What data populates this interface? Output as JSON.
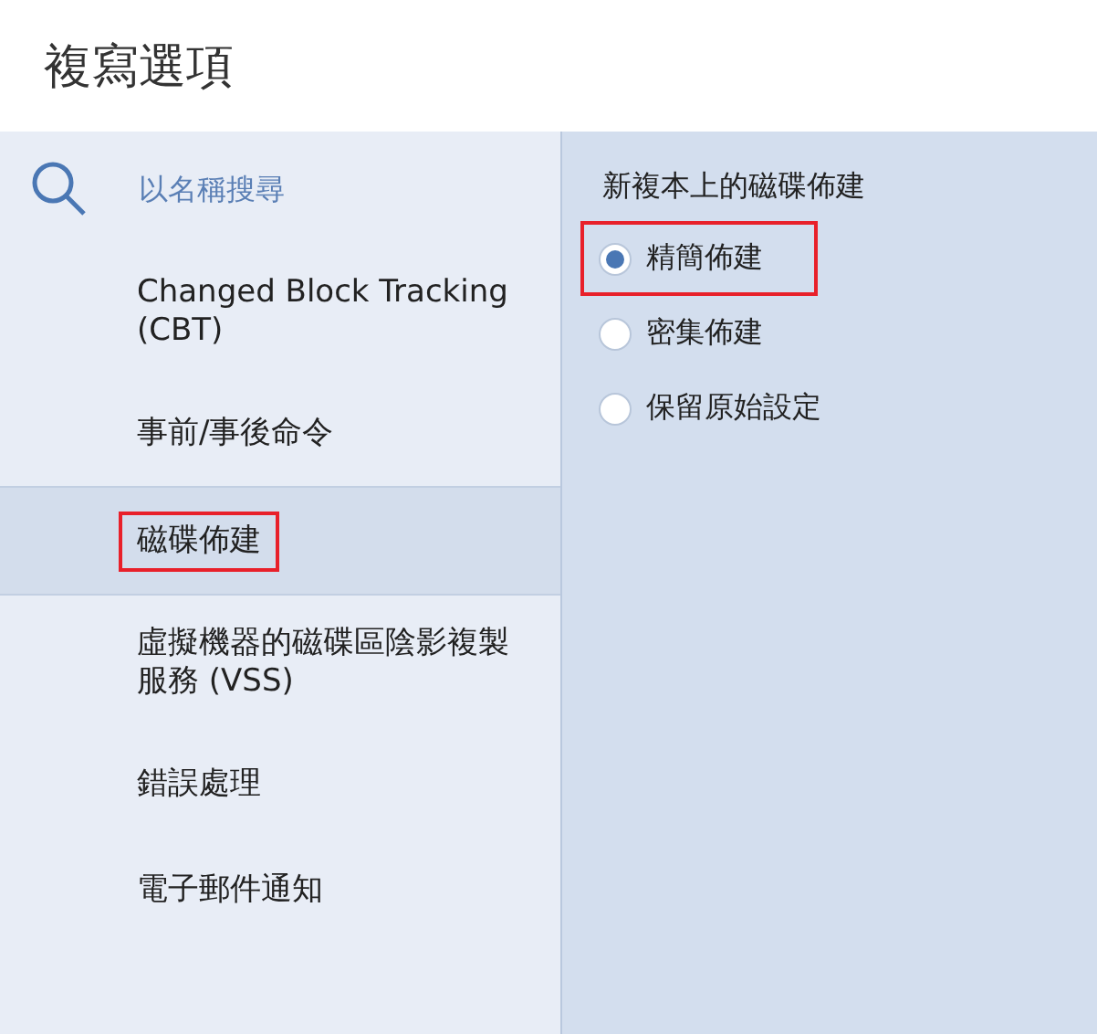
{
  "window": {
    "title": "複寫選項"
  },
  "sidebar": {
    "search": {
      "placeholder": "以名稱搜尋"
    },
    "items": [
      {
        "label": "Changed Block Tracking (CBT)",
        "selected": false,
        "highlighted": false
      },
      {
        "label": "事前/事後命令",
        "selected": false,
        "highlighted": false
      },
      {
        "label": "磁碟佈建",
        "selected": true,
        "highlighted": true
      },
      {
        "label": "虛擬機器的磁碟區陰影複製服務 (VSS)",
        "selected": false,
        "highlighted": false
      },
      {
        "label": "錯誤處理",
        "selected": false,
        "highlighted": false
      },
      {
        "label": "電子郵件通知",
        "selected": false,
        "highlighted": false
      }
    ]
  },
  "panel": {
    "heading": "新複本上的磁碟佈建",
    "options": [
      {
        "label": "精簡佈建",
        "selected": true,
        "highlighted": true
      },
      {
        "label": "密集佈建",
        "selected": false,
        "highlighted": false
      },
      {
        "label": "保留原始設定",
        "selected": false,
        "highlighted": false
      }
    ]
  }
}
